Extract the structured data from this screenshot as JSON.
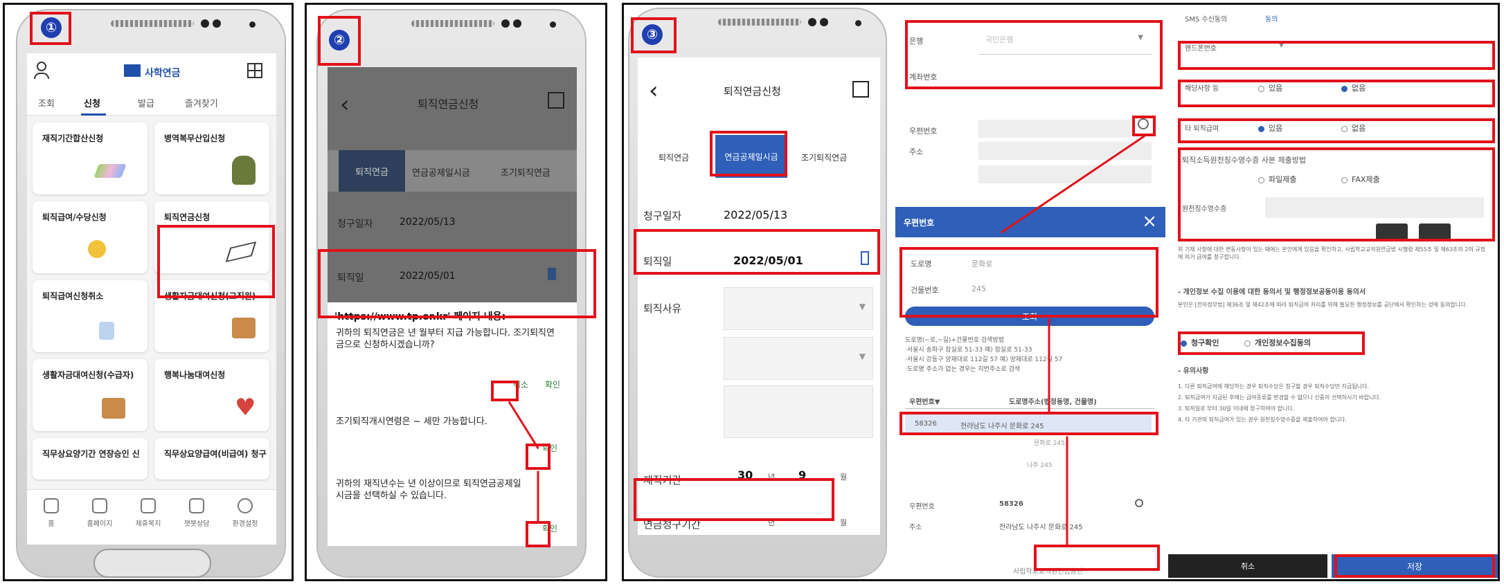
{
  "steps": {
    "one": "①",
    "two": "②",
    "three": "③"
  },
  "p1": {
    "app_name": "사학연금",
    "tabs": [
      "조회",
      "신청",
      "발급",
      "즐겨찾기"
    ],
    "cards": [
      "재직기간합산신청",
      "병역복무산입신청",
      "퇴직급여/수당신청",
      "퇴직연금신청",
      "퇴직급여신청취소",
      "생활자금대여신청(교직원)",
      "생활자금대여신청(수급자)",
      "행복나눔대여신청",
      "직무상요양기간 연장승인 신",
      "직무상요양급여(비급여) 청구"
    ],
    "nav": [
      "홈",
      "홈페이지",
      "제휴복지",
      "챗봇상담",
      "환경설정"
    ]
  },
  "p2": {
    "title": "퇴직연금신청",
    "tabs": [
      "퇴직연금",
      "연금공제일시금",
      "조기퇴직연금"
    ],
    "claim_label": "청구일자",
    "claim_date": "2022/05/13",
    "retire_label": "퇴직일",
    "retire_date": "2022/05/01",
    "dialog_title": "'https://www.tp.or.kr' 페이지 내용:",
    "dialog1_text": "귀하의 퇴직연금은      년  월부터 지급 가능합니다. 조기퇴직연금으로 신청하시겠습니까?",
    "cancel": "취소",
    "confirm": "확인",
    "dialog2_text": "조기퇴직개시연령은    ~   세만 가능합니다.",
    "dialog3_text": "귀하의 재직년수는      년 이상이므로 퇴직연금공제일시금을 선택하실 수 있습니다."
  },
  "p3": {
    "title": "퇴직연금신청",
    "tabs": [
      "퇴직연금",
      "연금공제일시금",
      "조기퇴직연금"
    ],
    "claim_label": "청구일자",
    "claim_date": "2022/05/13",
    "retire_label": "퇴직일",
    "retire_date": "2022/05/01",
    "reason_label": "퇴직사유",
    "service_label": "재직기간",
    "service_years": "30",
    "year_unit": "년",
    "service_months": "9",
    "month_unit": "월",
    "pension_period_label": "연금청구기간"
  },
  "p4": {
    "bank_label": "은행",
    "bank_value": "국민은행",
    "account_label": "계좌번호",
    "postcode_label": "우편번호",
    "address_label": "주소",
    "popup_title": "우편번호",
    "road_label": "도로명",
    "road_value": "문화로",
    "building_label": "건물번호",
    "building_value": "245",
    "search_btn": "조회",
    "help_text": "도로명(~로,~길)+건물번호 검색방법\n·서울시 송파구 잠실로 51-33 예) 잠실로 51-33\n·서울시 강동구 양재대로 112길 57 예) 양재대로 112길 57\n·도로명 주소가 없는 경우는 지번주소로 검색",
    "result_col1": "우편번호▼",
    "result_col2": "도로명주소(법정동명, 건물명)",
    "result_code": "58326",
    "result_addr": "전라남도 나주시 문화로 245",
    "result_sub1": "문화로 245",
    "result_sub2": "나주 245",
    "final_postcode_label": "우편번호",
    "final_postcode": "58326",
    "final_address_label": "주소",
    "final_address": "전라남도 나주시 문화로 245",
    "footer": "사립학교교직원연금공단"
  },
  "p5": {
    "sms_label": "SMS 수신동의",
    "sms_value": "동의",
    "phone_label": "핸드폰번호",
    "tax_label": "해당사항 등",
    "radio_yes": "있음",
    "radio_no": "없음",
    "other_label": "타 퇴직급여",
    "doc_title": "퇴직소득원천징수영수증 사본 제출방법",
    "file_submit": "파일제출",
    "fax_submit": "FAX제출",
    "receipt_label": "원천징수영수증",
    "notice1": "위 기재 사항에 대한 변동사항이 있는 때에는 본인에게 있음을 확인하고, 사립학교교직원연금법 시행령 제55조 및 제63조의 2의 규정에 의거 급여를 청구합니다.",
    "consent_heading": "- 개인정보 수집 이용에 대한 동의서 및 행정정보공동이용 동의서",
    "consent_text": "본인은 [전자정부법] 제36조 및 제42조에 따라 퇴직급여 처리를 위해 필요한 행정정보를 공단에서 확인하는 것에 동의합니다.",
    "claim_confirm": "청구확인",
    "privacy_consent": "개인정보수집동의",
    "caution_title": "- 유의사항",
    "caution_text": "1. 다른 퇴직급여에 해당하는 경우 퇴직수당은 청구할 경우 퇴직수당만 지급됩니다.\n2. 퇴직급여가 지급된 후에는 급여종류를 변경할 수 없으니 신중히 선택하시기 바랍니다.\n3. 퇴직일로 부터 30일 이내에 청구하여야 합니다.\n4. 타 기관의 퇴직급여가 있는 경우 원천징수영수증을 제출하여야 합니다.",
    "cancel": "취소",
    "save": "저장"
  }
}
